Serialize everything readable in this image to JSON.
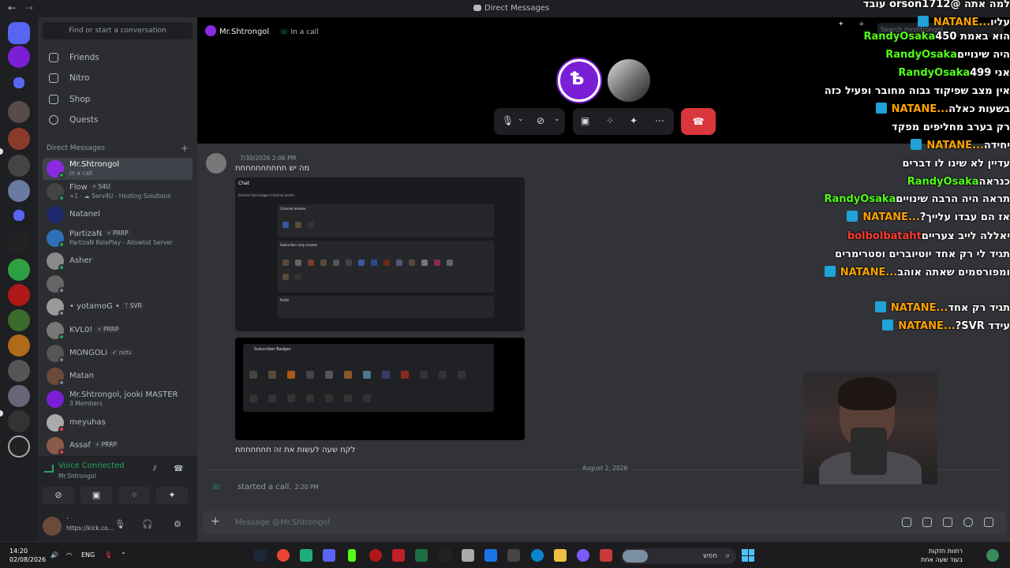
{
  "titlebar": {
    "title": "Direct Messages"
  },
  "sidebar": {
    "search_placeholder": "Find or start a conversation",
    "nav": [
      "Friends",
      "Nitro",
      "Shop",
      "Quests"
    ],
    "dm_header": "Direct Messages",
    "dms": [
      {
        "name": "Mr.Shtrongol",
        "sub": "In a call",
        "status": "online",
        "color": "#8a2be2"
      },
      {
        "name": "Flow",
        "tag": "⚡ S4U",
        "sub": "+1 · ☁ Serv4U - Hosting Solutions",
        "status": "online",
        "color": "#444"
      },
      {
        "name": "Natanel",
        "status": "none",
        "color": "#1c2a6b"
      },
      {
        "name": "PartizaN",
        "tag": "⚡ PRRP",
        "sub": "PartizaN RolePlay - Allowlist Server",
        "status": "online",
        "color": "#2e6fb7"
      },
      {
        "name": "Asher",
        "status": "online",
        "color": "#8a8a8a"
      },
      {
        "name": "",
        "status": "off",
        "color": "#666"
      },
      {
        "name": "• yotamoG •",
        "tag": "ᛉ SVR",
        "status": "off",
        "color": "#999"
      },
      {
        "name": "KVL0!",
        "tag": "⚡ PRRP",
        "status": "online",
        "color": "#777"
      },
      {
        "name": "MONGOLi",
        "tag": "✓ גלגה",
        "status": "off",
        "color": "#555"
      },
      {
        "name": "Matan",
        "status": "off",
        "color": "#6b4a3a"
      },
      {
        "name": "Mr.Shtrongol, jooki MASTER",
        "sub": "3 Members",
        "status": "none",
        "color": "#7b1fd6"
      },
      {
        "name": "meyuhas",
        "status": "dnd",
        "color": "#aaa"
      },
      {
        "name": "Assaf",
        "tag": "⚡ PRRP",
        "status": "dnd",
        "color": "#8a5a4a"
      }
    ]
  },
  "voice": {
    "status": "Voice Connected",
    "channel": "Mr.Shtrongol"
  },
  "user": {
    "name": "·",
    "status": "https://kick.co..."
  },
  "call": {
    "name": "Mr.Shtrongol",
    "state": "In a call"
  },
  "messages": {
    "timestamp": "7/30/2026 2:06 PM",
    "text1": "מה יש חחחחחחחחחח",
    "shot1_title": "Chat",
    "shot1_tabs": "Emotes   Sub badges   Channel points",
    "shot1_box1": "Channel emotes",
    "shot1_box2": "Subscriber only emotes",
    "shot1_box3": "Prefix",
    "shot2_title": "Subscriber Badges",
    "text2": "לקח שעה לעשות את זה חחחחחחח",
    "date_divider": "August 2, 2026",
    "call_text": "started a call.",
    "call_time": "2:20 PM"
  },
  "composer": {
    "placeholder": "Message @Mr.Shtrongol"
  },
  "search": {
    "placeholder": "Search mrshtrongol"
  },
  "stream_chat": [
    {
      "user": "NATANE...",
      "color": "orange",
      "badge": true,
      "text": "למה אתה @orson1712 עובד עליו"
    },
    {
      "user": "RandyOsaka",
      "color": "green",
      "text": "הוא באמת 450"
    },
    {
      "user": "RandyOsaka",
      "color": "green",
      "text": "היה שינויים"
    },
    {
      "user": "RandyOsaka",
      "color": "green",
      "text": "אני 499"
    },
    {
      "user": "NATANE...",
      "color": "orange",
      "badge": true,
      "text": "אין מצב שפיקוד גבוה מחובר ופעיל כזה בשעות כאלה"
    },
    {
      "user": "NATANE...",
      "color": "orange",
      "badge": true,
      "text": "רק בערב מחליפים מפקד יחידה"
    },
    {
      "user": "RandyOsaka",
      "color": "green",
      "text": "עדיין לא שינו לו דברים כנראה"
    },
    {
      "user": "RandyOsaka",
      "color": "green",
      "text": "תראה היה הרבה שינויים"
    },
    {
      "user": "NATANE...",
      "color": "orange",
      "badge": true,
      "text": "אז הם עבדו עלייך?"
    },
    {
      "user": "bolbolbataht",
      "color": "red",
      "text": "יאללה לייב צעריים"
    },
    {
      "user": "NATANE...",
      "color": "orange",
      "badge": true,
      "text": "תגיד לי רק אחד יוטיוברים וסטרימרים ומפורסמים שאתה אוהב"
    },
    {
      "user": "NATANE...",
      "color": "orange",
      "badge": true,
      "text": "תגיד רק אחד"
    },
    {
      "user": "NATANE...",
      "color": "orange",
      "badge": true,
      "text": "עידד SVR?"
    }
  ],
  "taskbar": {
    "time": "14:20",
    "date": "02/08/2026",
    "lang": "ENG",
    "search": "חפש",
    "notif_line1": "רחוות חזקות",
    "notif_line2": "בעוד שעה אחת"
  }
}
